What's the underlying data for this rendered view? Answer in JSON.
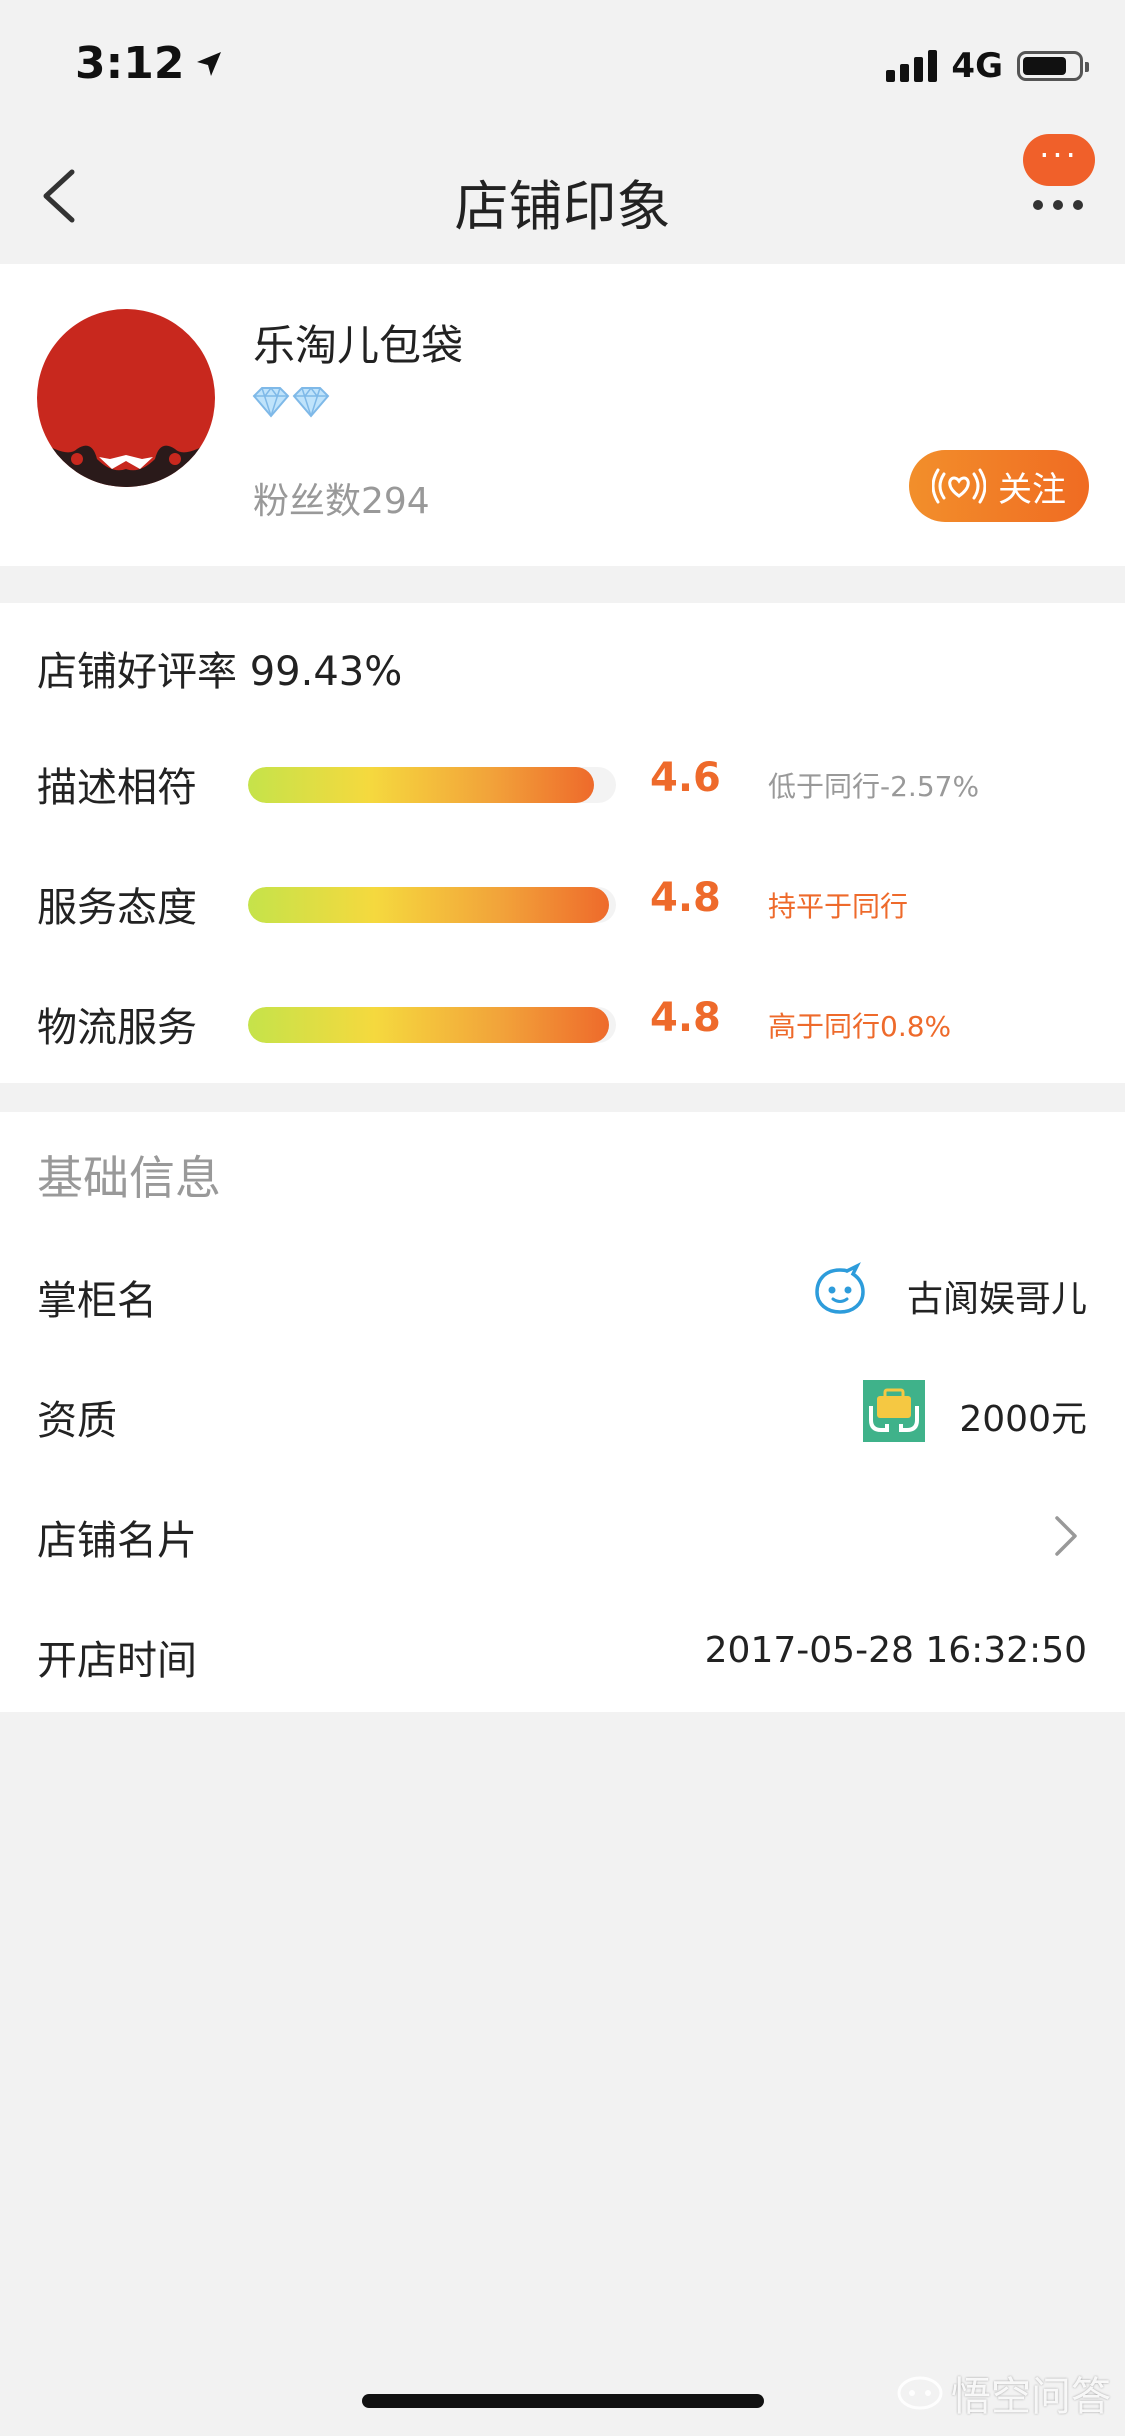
{
  "status_bar": {
    "time": "3:12",
    "network": "4G",
    "signal_bars": 4,
    "battery_level": 0.8
  },
  "nav": {
    "title": "店铺印象",
    "message_bubble": "···"
  },
  "shop": {
    "name": "乐淘儿包袋",
    "fans": "粉丝数294",
    "diamond_count": 2,
    "follow_label": "关注",
    "avatar_color": "#c8281e"
  },
  "ratings": {
    "good_rate": "店铺好评率 99.43%",
    "items": [
      {
        "label": "描述相符",
        "score": "4.6",
        "fill": 0.94,
        "compare": "低于同行-2.57%",
        "compare_color": "#999999"
      },
      {
        "label": "服务态度",
        "score": "4.8",
        "fill": 0.98,
        "compare": "持平于同行",
        "compare_color": "#ee6a2b"
      },
      {
        "label": "物流服务",
        "score": "4.8",
        "fill": 0.98,
        "compare": "高于同行0.8%",
        "compare_color": "#ee6a2b"
      }
    ]
  },
  "basic_info": {
    "title": "基础信息",
    "rows": [
      {
        "label": "掌柜名",
        "value": "古阆娱哥儿"
      },
      {
        "label": "资质",
        "value": "2000元"
      },
      {
        "label": "店铺名片",
        "value": ""
      },
      {
        "label": "开店时间",
        "value": "2017-05-28 16:32:50"
      }
    ]
  },
  "watermark": {
    "text": "悟空问答"
  },
  "colors": {
    "accent": "#ee6a2b",
    "background": "#f2f2f2",
    "card": "#ffffff"
  }
}
